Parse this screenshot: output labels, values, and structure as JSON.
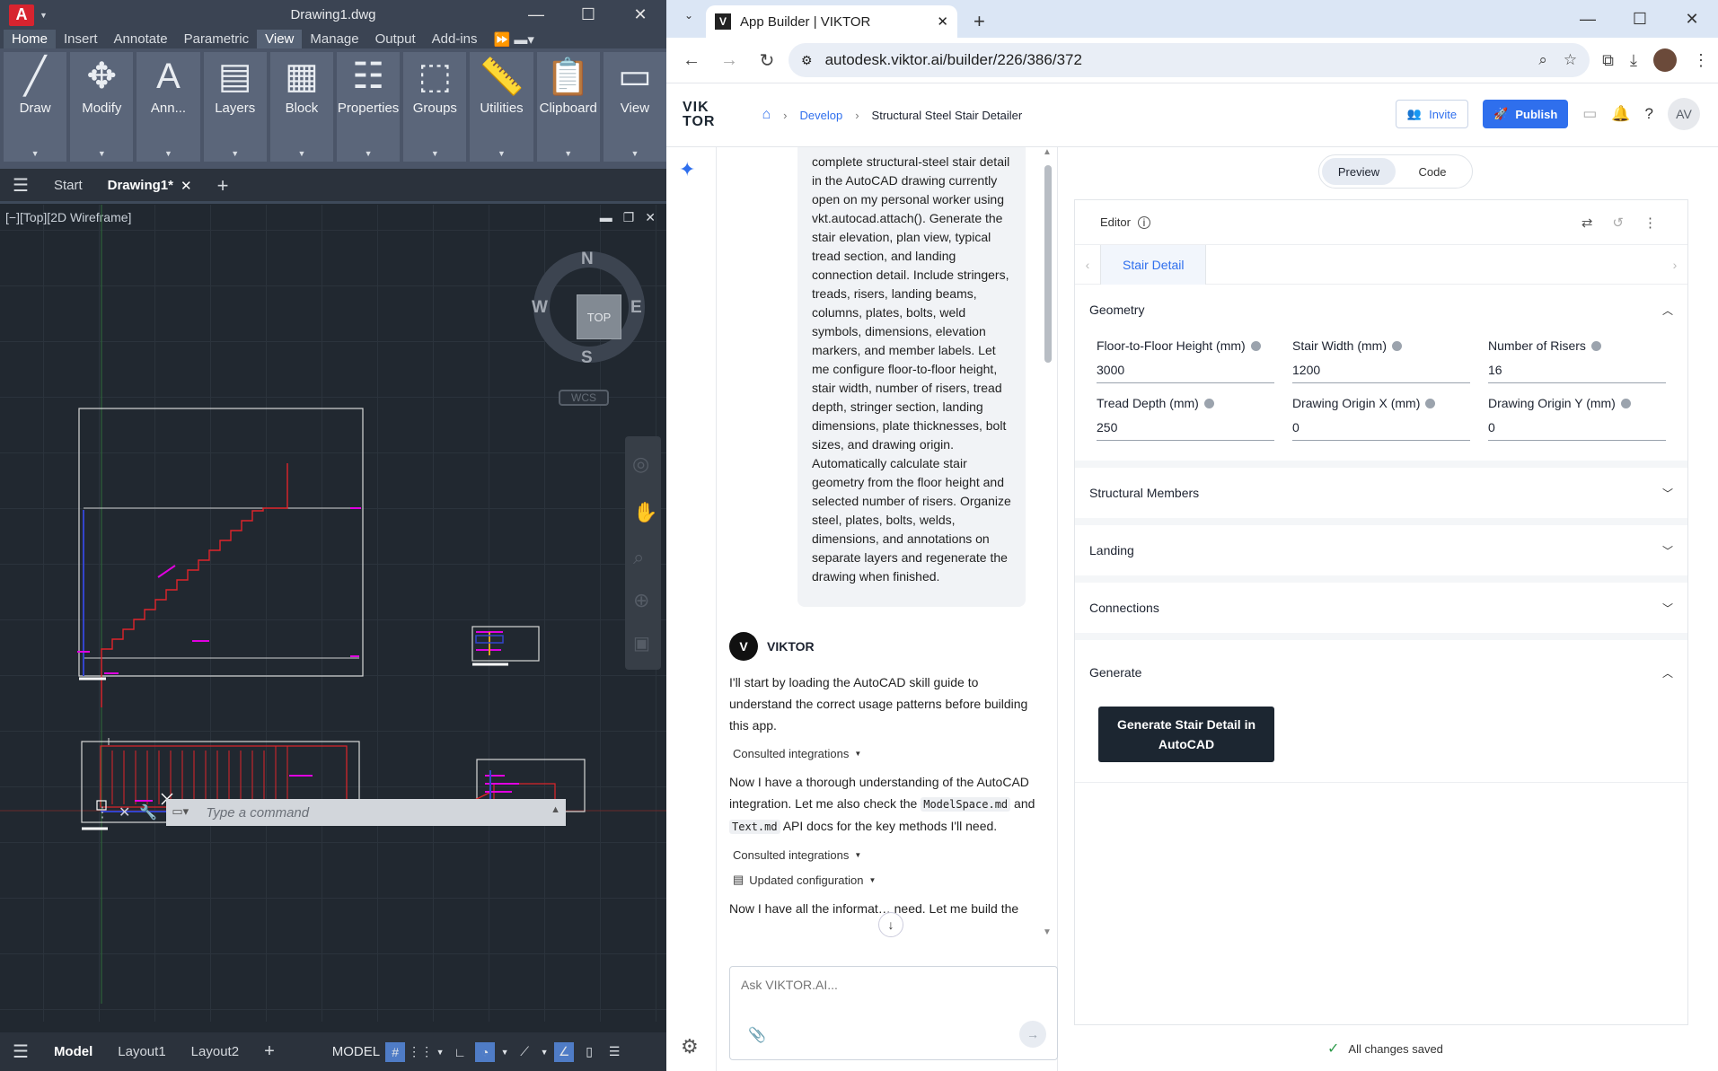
{
  "acad": {
    "doc_title": "Drawing1.dwg",
    "logo": "A",
    "ribbon_tabs": [
      "Home",
      "Insert",
      "Annotate",
      "Parametric",
      "View",
      "Manage",
      "Output",
      "Add-ins"
    ],
    "ribbon_panels": [
      {
        "label": "Draw",
        "icon": "draw-icon",
        "glyph": "╱"
      },
      {
        "label": "Modify",
        "icon": "modify-move-icon",
        "glyph": "✥"
      },
      {
        "label": "Ann...",
        "icon": "annotation-icon",
        "glyph": "A"
      },
      {
        "label": "Layers",
        "icon": "layers-icon",
        "glyph": "▤"
      },
      {
        "label": "Block",
        "icon": "block-icon",
        "glyph": "▦"
      },
      {
        "label": "Properties",
        "icon": "properties-icon",
        "glyph": "☷"
      },
      {
        "label": "Groups",
        "icon": "groups-icon",
        "glyph": "⬚"
      },
      {
        "label": "Utilities",
        "icon": "utilities-icon",
        "glyph": "📏"
      },
      {
        "label": "Clipboard",
        "icon": "clipboard-icon",
        "glyph": "📋"
      },
      {
        "label": "View",
        "icon": "view-icon",
        "glyph": "▭"
      }
    ],
    "file_tabs": {
      "start": "Start",
      "drawing": "Drawing1*"
    },
    "viewport_label": "[−][Top][2D Wireframe]",
    "compass": {
      "n": "N",
      "s": "S",
      "e": "E",
      "w": "W",
      "cube": "TOP",
      "wcs": "WCS"
    },
    "command_placeholder": "Type a command",
    "layout_tabs": [
      "Model",
      "Layout1",
      "Layout2"
    ],
    "model_indicator": "MODEL"
  },
  "browser": {
    "tab_title": "App Builder | VIKTOR",
    "tab_favicon": "V",
    "url": "autodesk.viktor.ai/builder/226/386/372",
    "profile_initials": "AV"
  },
  "viktor": {
    "logo_line1": "VIK",
    "logo_line2": "TOR",
    "breadcrumb": {
      "develop": "Develop",
      "current": "Structural Steel Stair Detailer"
    },
    "invite": "Invite",
    "publish": "Publish",
    "user_initials": "AV",
    "user_message": "complete structural-steel stair detail in the AutoCAD drawing currently open on my personal worker using vkt.autocad.attach(). Generate the stair elevation, plan view, typical tread section, and landing connection detail. Include stringers, treads, risers, landing beams, columns, plates, bolts, weld symbols, dimensions, elevation markers, and member labels. Let me configure floor-to-floor height, stair width, number of risers, tread depth, stringer section, landing dimensions, plate thicknesses, bolt sizes, and drawing origin. Automatically calculate stair geometry from the floor height and selected number of risers. Organize steel, plates, bolts, welds, dimensions, and annotations on separate layers and regenerate the drawing when finished.",
    "assistant_name": "VIKTOR",
    "assistant_avatar": "V",
    "msg1": "I'll start by loading the AutoCAD skill guide to understand the correct usage patterns before building this app.",
    "consulted1": "Consulted integrations",
    "msg2_a": "Now I have a thorough understanding of the AutoCAD integration. Let me also check the ",
    "msg2_code1": "ModelSpace.md",
    "msg2_b": " and ",
    "msg2_code2": "Text.md",
    "msg2_c": " API docs for the key methods I'll need.",
    "consulted2": "Consulted integrations",
    "updated_config": "Updated configuration",
    "msg3": "Now I have all the informat… need. Let me build the",
    "ask_placeholder": "Ask VIKTOR.AI...",
    "toggle": {
      "preview": "Preview",
      "code": "Code"
    },
    "editor_label": "Editor",
    "tab_label": "Stair Detail",
    "sections": {
      "geometry": "Geometry",
      "structural": "Structural Members",
      "landing": "Landing",
      "connections": "Connections",
      "generate": "Generate"
    },
    "fields": [
      {
        "label": "Floor-to-Floor Height (mm)",
        "value": "3000"
      },
      {
        "label": "Stair Width (mm)",
        "value": "1200"
      },
      {
        "label": "Number of Risers",
        "value": "16"
      },
      {
        "label": "Tread Depth (mm)",
        "value": "250"
      },
      {
        "label": "Drawing Origin X (mm)",
        "value": "0"
      },
      {
        "label": "Drawing Origin Y (mm)",
        "value": "0"
      }
    ],
    "generate_button": "Generate Stair Detail in AutoCAD",
    "saved_status": "All changes saved"
  },
  "colors": {
    "accent": "#2f6fed",
    "acad_red": "#d7242f",
    "cad_magenta": "#e000e0",
    "cad_red": "#e0242a"
  }
}
